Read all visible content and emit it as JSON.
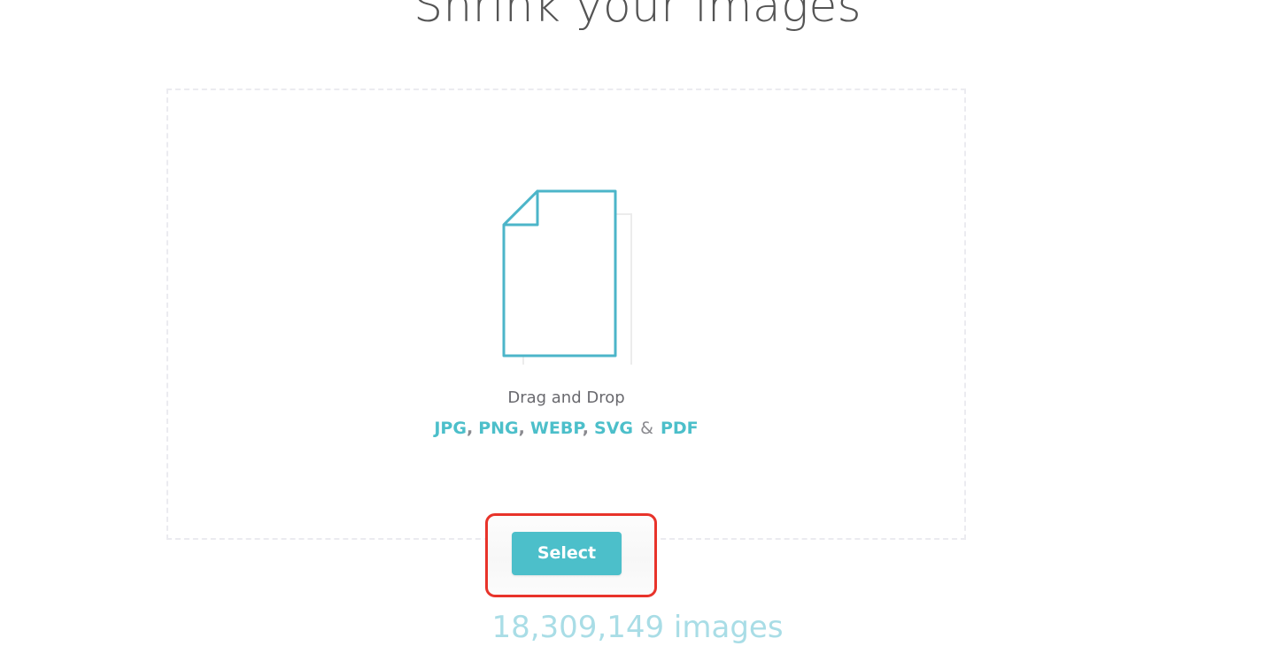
{
  "page": {
    "title": "Shrink your images",
    "background_color": "#ffffff",
    "accent_color": "#4cbfca",
    "muted_text_color": "#69696e",
    "highlight_color": "#e8332a"
  },
  "dropzone": {
    "icon_name": "document-page-icon",
    "drag_text": "Drag and Drop",
    "formats": {
      "items": [
        "JPG",
        "PNG",
        "WEBP",
        "SVG",
        "PDF"
      ],
      "separator": ",",
      "last_separator": "&"
    },
    "border_style": "dashed",
    "border_color": "#ebebf0"
  },
  "actions": {
    "select_label": "Select"
  },
  "annotation": {
    "target": "select-button",
    "color": "#e8332a",
    "shape": "rounded-rectangle"
  },
  "footer": {
    "counter_text": "18,309,149 images"
  }
}
